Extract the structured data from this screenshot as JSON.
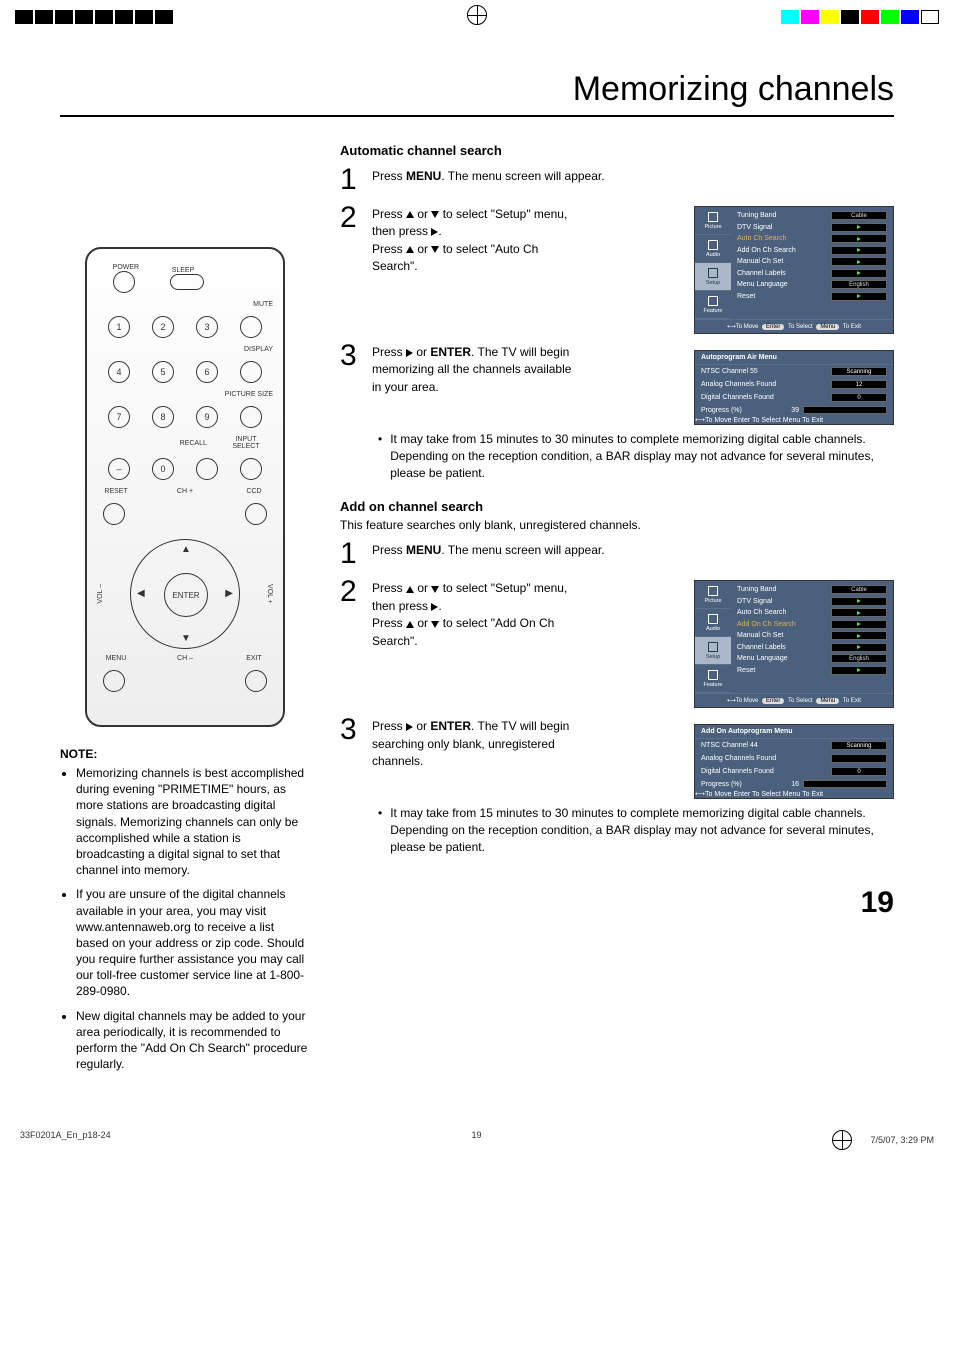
{
  "title": "Memorizing channels",
  "page_number": "19",
  "footer": {
    "docid": "33F0201A_En_p18-24",
    "page": "19",
    "datetime": "7/5/07, 3:29 PM"
  },
  "remote": {
    "power": "POWER",
    "sleep": "SLEEP",
    "mute": "MUTE",
    "display": "DISPLAY",
    "picsize": "PICTURE SIZE",
    "recall": "RECALL",
    "inputsel": "INPUT SELECT",
    "reset": "RESET",
    "ccd": "CCD",
    "chp": "CH +",
    "chm": "CH –",
    "volp": "VOL +",
    "volm": "VOL –",
    "enter": "ENTER",
    "menu": "MENU",
    "exit": "EXIT",
    "dash": "–",
    "zero": "0",
    "n1": "1",
    "n2": "2",
    "n3": "3",
    "n4": "4",
    "n5": "5",
    "n6": "6",
    "n7": "7",
    "n8": "8",
    "n9": "9"
  },
  "note": {
    "head": "NOTE:",
    "items": [
      "Memorizing channels is best accomplished during evening \"PRIMETIME\" hours, as more stations are broadcasting digital signals. Memorizing channels can only be accomplished while a station is broadcasting a digital signal to set that channel into memory.",
      "If you are unsure of the digital channels available in your area, you may visit www.antennaweb.org to receive a list based on your address or zip code. Should you require further assistance you may call our toll-free customer service line at 1-800-289-0980.",
      "New digital channels may be added to your area periodically, it is recommended to perform the \"Add On Ch Search\" procedure regularly."
    ]
  },
  "auto": {
    "head": "Automatic channel search",
    "step1_a": "Press ",
    "step1_menu": "MENU",
    "step1_b": ".  The menu screen will appear.",
    "step2_a": "Press ",
    "step2_b": " or ",
    "step2_c": " to select \"Setup\" menu, then press ",
    "step2_d": ".",
    "step2_e": "Press ",
    "step2_f": " or ",
    "step2_g": " to select \"Auto Ch Search\".",
    "step3_a": "Press  ",
    "step3_b": " or ",
    "step3_enter": "ENTER",
    "step3_c": ". The TV will begin memorizing all the channels available in your area.",
    "bullet": "It may take from 15 minutes to 30 minutes to complete memorizing digital cable channels.\nDepending on the reception condition, a BAR display may not advance for several minutes, please be patient."
  },
  "addon": {
    "head": "Add on channel search",
    "sub": "This feature searches only blank, unregistered channels.",
    "step1_a": "Press ",
    "step1_menu": "MENU",
    "step1_b": ". The menu screen will appear.",
    "step2_a": "Press ",
    "step2_b": " or ",
    "step2_c": " to select \"Setup\" menu, then press ",
    "step2_d": ".",
    "step2_e": "Press ",
    "step2_f": " or ",
    "step2_g": " to select \"Add On Ch Search\".",
    "step3_a": "Press  ",
    "step3_b": " or ",
    "step3_enter": "ENTER",
    "step3_c": ". The TV will begin searching only blank, unregistered channels.",
    "bullet": "It may take from 15 minutes to 30 minutes to complete memorizing digital cable channels.\nDepending on the reception condition, a BAR display may not advance for several minutes, please be patient."
  },
  "osd_tabs": [
    "Picture",
    "Audio",
    "Setup",
    "Feature"
  ],
  "osd_setup_rows": [
    {
      "label": "Tuning Band",
      "val": "Cable"
    },
    {
      "label": "DTV Signal",
      "val": "▶"
    },
    {
      "label": "Auto Ch Search",
      "val": "▶"
    },
    {
      "label": "Add On Ch Search",
      "val": "▶"
    },
    {
      "label": "Manual Ch Set",
      "val": "▶"
    },
    {
      "label": "Channel Labels",
      "val": "▶"
    },
    {
      "label": "Menu Language",
      "val": "English"
    },
    {
      "label": "Reset",
      "val": "▶"
    }
  ],
  "osd_footer": {
    "move": "To Move",
    "enter": "Enter",
    "select": "To Select",
    "menu": "Menu",
    "exit": "To Exit"
  },
  "osd_auto_prog": {
    "title": "Autoprogram Air Menu",
    "rows": [
      {
        "label": "NTSC Channel 55",
        "val": "Scanning"
      },
      {
        "label": "Analog Channels Found",
        "val": "12"
      },
      {
        "label": "Digital Channels Found",
        "val": "0"
      }
    ],
    "progress_label": "Progress (%)",
    "progress_val": "39"
  },
  "osd_addon_prog": {
    "title": "Add On Autoprogram Menu",
    "rows": [
      {
        "label": "NTSC Channel 44",
        "val": "Scanning"
      },
      {
        "label": "Analog Channels Found",
        "val": ""
      },
      {
        "label": "Digital Channels Found",
        "val": "0"
      }
    ],
    "progress_label": "Progress (%)",
    "progress_val": "16"
  },
  "osd_highlight": {
    "auto": 2,
    "addon": 3
  }
}
